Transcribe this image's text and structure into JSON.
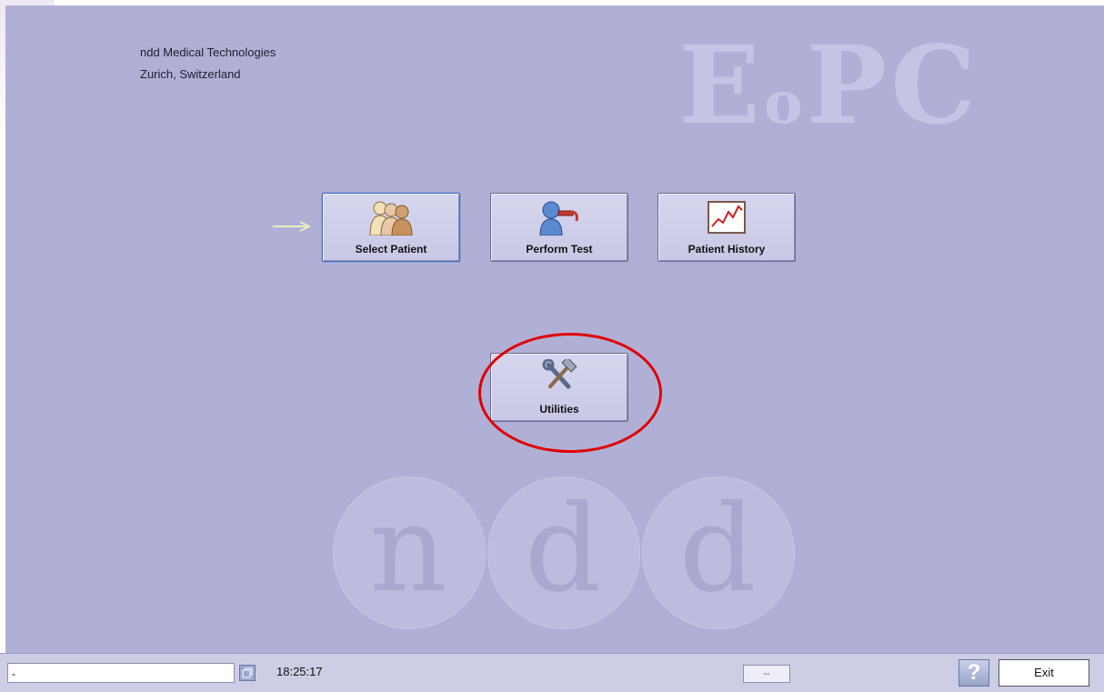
{
  "company": {
    "name": "ndd Medical Technologies",
    "location": "Zurich, Switzerland"
  },
  "watermark": {
    "product_prefix": "E",
    "product_mid": "o",
    "product_suffix": "PC",
    "brand_letters": [
      "n",
      "d",
      "d"
    ]
  },
  "tiles": {
    "select_patient": {
      "label": "Select Patient",
      "icon": "patients-icon",
      "selected": true
    },
    "perform_test": {
      "label": "Perform Test",
      "icon": "spirometry-test-icon"
    },
    "patient_history": {
      "label": "Patient History",
      "icon": "history-chart-icon"
    },
    "utilities": {
      "label": "Utilities",
      "icon": "tools-icon"
    }
  },
  "status_bar": {
    "field_value": "-",
    "time": "18:25:17",
    "middle_field": "--",
    "help_label": "?",
    "exit_label": "Exit"
  },
  "colors": {
    "background": "#b0b0d6",
    "highlight_ring": "#e00000",
    "status_bar": "#cdcde6"
  }
}
